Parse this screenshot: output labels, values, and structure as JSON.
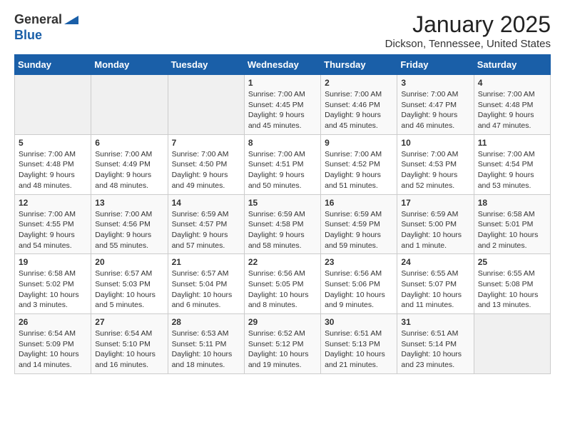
{
  "header": {
    "logo_general": "General",
    "logo_blue": "Blue",
    "title": "January 2025",
    "subtitle": "Dickson, Tennessee, United States"
  },
  "calendar": {
    "days_of_week": [
      "Sunday",
      "Monday",
      "Tuesday",
      "Wednesday",
      "Thursday",
      "Friday",
      "Saturday"
    ],
    "weeks": [
      [
        {
          "day": "",
          "info": ""
        },
        {
          "day": "",
          "info": ""
        },
        {
          "day": "",
          "info": ""
        },
        {
          "day": "1",
          "info": "Sunrise: 7:00 AM\nSunset: 4:45 PM\nDaylight: 9 hours\nand 45 minutes."
        },
        {
          "day": "2",
          "info": "Sunrise: 7:00 AM\nSunset: 4:46 PM\nDaylight: 9 hours\nand 45 minutes."
        },
        {
          "day": "3",
          "info": "Sunrise: 7:00 AM\nSunset: 4:47 PM\nDaylight: 9 hours\nand 46 minutes."
        },
        {
          "day": "4",
          "info": "Sunrise: 7:00 AM\nSunset: 4:48 PM\nDaylight: 9 hours\nand 47 minutes."
        }
      ],
      [
        {
          "day": "5",
          "info": "Sunrise: 7:00 AM\nSunset: 4:48 PM\nDaylight: 9 hours\nand 48 minutes."
        },
        {
          "day": "6",
          "info": "Sunrise: 7:00 AM\nSunset: 4:49 PM\nDaylight: 9 hours\nand 48 minutes."
        },
        {
          "day": "7",
          "info": "Sunrise: 7:00 AM\nSunset: 4:50 PM\nDaylight: 9 hours\nand 49 minutes."
        },
        {
          "day": "8",
          "info": "Sunrise: 7:00 AM\nSunset: 4:51 PM\nDaylight: 9 hours\nand 50 minutes."
        },
        {
          "day": "9",
          "info": "Sunrise: 7:00 AM\nSunset: 4:52 PM\nDaylight: 9 hours\nand 51 minutes."
        },
        {
          "day": "10",
          "info": "Sunrise: 7:00 AM\nSunset: 4:53 PM\nDaylight: 9 hours\nand 52 minutes."
        },
        {
          "day": "11",
          "info": "Sunrise: 7:00 AM\nSunset: 4:54 PM\nDaylight: 9 hours\nand 53 minutes."
        }
      ],
      [
        {
          "day": "12",
          "info": "Sunrise: 7:00 AM\nSunset: 4:55 PM\nDaylight: 9 hours\nand 54 minutes."
        },
        {
          "day": "13",
          "info": "Sunrise: 7:00 AM\nSunset: 4:56 PM\nDaylight: 9 hours\nand 55 minutes."
        },
        {
          "day": "14",
          "info": "Sunrise: 6:59 AM\nSunset: 4:57 PM\nDaylight: 9 hours\nand 57 minutes."
        },
        {
          "day": "15",
          "info": "Sunrise: 6:59 AM\nSunset: 4:58 PM\nDaylight: 9 hours\nand 58 minutes."
        },
        {
          "day": "16",
          "info": "Sunrise: 6:59 AM\nSunset: 4:59 PM\nDaylight: 9 hours\nand 59 minutes."
        },
        {
          "day": "17",
          "info": "Sunrise: 6:59 AM\nSunset: 5:00 PM\nDaylight: 10 hours\nand 1 minute."
        },
        {
          "day": "18",
          "info": "Sunrise: 6:58 AM\nSunset: 5:01 PM\nDaylight: 10 hours\nand 2 minutes."
        }
      ],
      [
        {
          "day": "19",
          "info": "Sunrise: 6:58 AM\nSunset: 5:02 PM\nDaylight: 10 hours\nand 3 minutes."
        },
        {
          "day": "20",
          "info": "Sunrise: 6:57 AM\nSunset: 5:03 PM\nDaylight: 10 hours\nand 5 minutes."
        },
        {
          "day": "21",
          "info": "Sunrise: 6:57 AM\nSunset: 5:04 PM\nDaylight: 10 hours\nand 6 minutes."
        },
        {
          "day": "22",
          "info": "Sunrise: 6:56 AM\nSunset: 5:05 PM\nDaylight: 10 hours\nand 8 minutes."
        },
        {
          "day": "23",
          "info": "Sunrise: 6:56 AM\nSunset: 5:06 PM\nDaylight: 10 hours\nand 9 minutes."
        },
        {
          "day": "24",
          "info": "Sunrise: 6:55 AM\nSunset: 5:07 PM\nDaylight: 10 hours\nand 11 minutes."
        },
        {
          "day": "25",
          "info": "Sunrise: 6:55 AM\nSunset: 5:08 PM\nDaylight: 10 hours\nand 13 minutes."
        }
      ],
      [
        {
          "day": "26",
          "info": "Sunrise: 6:54 AM\nSunset: 5:09 PM\nDaylight: 10 hours\nand 14 minutes."
        },
        {
          "day": "27",
          "info": "Sunrise: 6:54 AM\nSunset: 5:10 PM\nDaylight: 10 hours\nand 16 minutes."
        },
        {
          "day": "28",
          "info": "Sunrise: 6:53 AM\nSunset: 5:11 PM\nDaylight: 10 hours\nand 18 minutes."
        },
        {
          "day": "29",
          "info": "Sunrise: 6:52 AM\nSunset: 5:12 PM\nDaylight: 10 hours\nand 19 minutes."
        },
        {
          "day": "30",
          "info": "Sunrise: 6:51 AM\nSunset: 5:13 PM\nDaylight: 10 hours\nand 21 minutes."
        },
        {
          "day": "31",
          "info": "Sunrise: 6:51 AM\nSunset: 5:14 PM\nDaylight: 10 hours\nand 23 minutes."
        },
        {
          "day": "",
          "info": ""
        }
      ]
    ]
  }
}
